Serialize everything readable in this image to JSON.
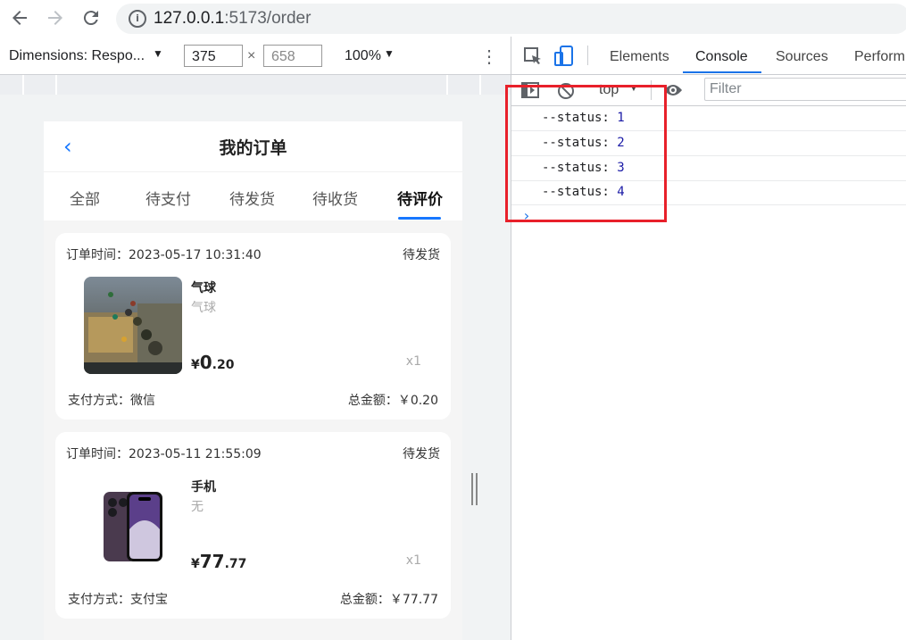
{
  "browser": {
    "back_icon": "arrow-left-icon",
    "forward_icon": "arrow-right-icon",
    "reload_icon": "reload-icon",
    "url_host": "127.0.0.1",
    "url_rest": ":5173/order"
  },
  "device_toolbar": {
    "dimensions_label": "Dimensions: Respo...",
    "width": "375",
    "times": "×",
    "height": "658",
    "zoom": "100%",
    "more": "⋮"
  },
  "app": {
    "nav": {
      "back": "‹",
      "title": "我的订单"
    },
    "tabs": [
      "全部",
      "待支付",
      "待发货",
      "待收货",
      "待评价"
    ],
    "active_tab": 4,
    "orders": [
      {
        "time_label": "订单时间：2023-05-17 10:31:40",
        "status": "待发货",
        "product_name": "气球",
        "product_desc": "气球",
        "price_currency": "¥",
        "price_int": "0",
        "price_dec": ".20",
        "quantity": "x1",
        "payment": "支付方式：微信",
        "total": "总金额：￥0.20",
        "image_icon": "balloon-photo"
      },
      {
        "time_label": "订单时间：2023-05-11 21:55:09",
        "status": "待发货",
        "product_name": "手机",
        "product_desc": "无",
        "price_currency": "¥",
        "price_int": "77",
        "price_dec": ".77",
        "quantity": "x1",
        "payment": "支付方式：支付宝",
        "total": "总金额：￥77.77",
        "image_icon": "phone-photo"
      }
    ]
  },
  "devtools": {
    "tabs": [
      "Elements",
      "Console",
      "Sources",
      "Perform"
    ],
    "active_tab": "Console",
    "context": "top",
    "filter_placeholder": "Filter",
    "console_lines": [
      {
        "text": "--status: ",
        "value": "1"
      },
      {
        "text": "--status: ",
        "value": "2"
      },
      {
        "text": "--status: ",
        "value": "3"
      },
      {
        "text": "--status: ",
        "value": "4"
      }
    ],
    "prompt": "›",
    "highlight_color": "#e8202a"
  }
}
